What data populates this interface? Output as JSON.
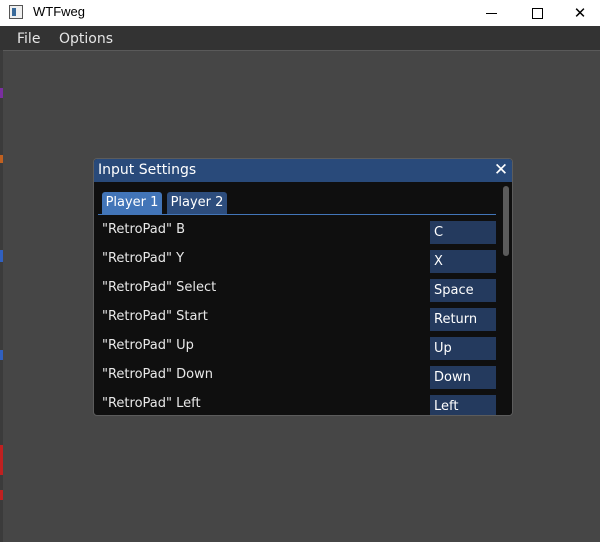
{
  "window": {
    "title": "WTFweg",
    "close_glyph": "✕"
  },
  "menubar": {
    "items": [
      {
        "label": "File"
      },
      {
        "label": "Options"
      }
    ]
  },
  "dialog": {
    "title": "Input Settings",
    "close_glyph": "✕",
    "tabs": [
      {
        "label": "Player 1",
        "active": true
      },
      {
        "label": "Player 2",
        "active": false
      }
    ],
    "rows": [
      {
        "label": "\"RetroPad\" B",
        "key": "C"
      },
      {
        "label": "\"RetroPad\" Y",
        "key": "X"
      },
      {
        "label": "\"RetroPad\" Select",
        "key": "Space"
      },
      {
        "label": "\"RetroPad\" Start",
        "key": "Return"
      },
      {
        "label": "\"RetroPad\" Up",
        "key": "Up"
      },
      {
        "label": "\"RetroPad\" Down",
        "key": "Down"
      },
      {
        "label": "\"RetroPad\" Left",
        "key": "Left"
      }
    ]
  },
  "colors": {
    "desktop": "#464646",
    "dialog_header": "#294a7a",
    "tab_active": "#4275b8",
    "key_button": "#243a5e"
  }
}
